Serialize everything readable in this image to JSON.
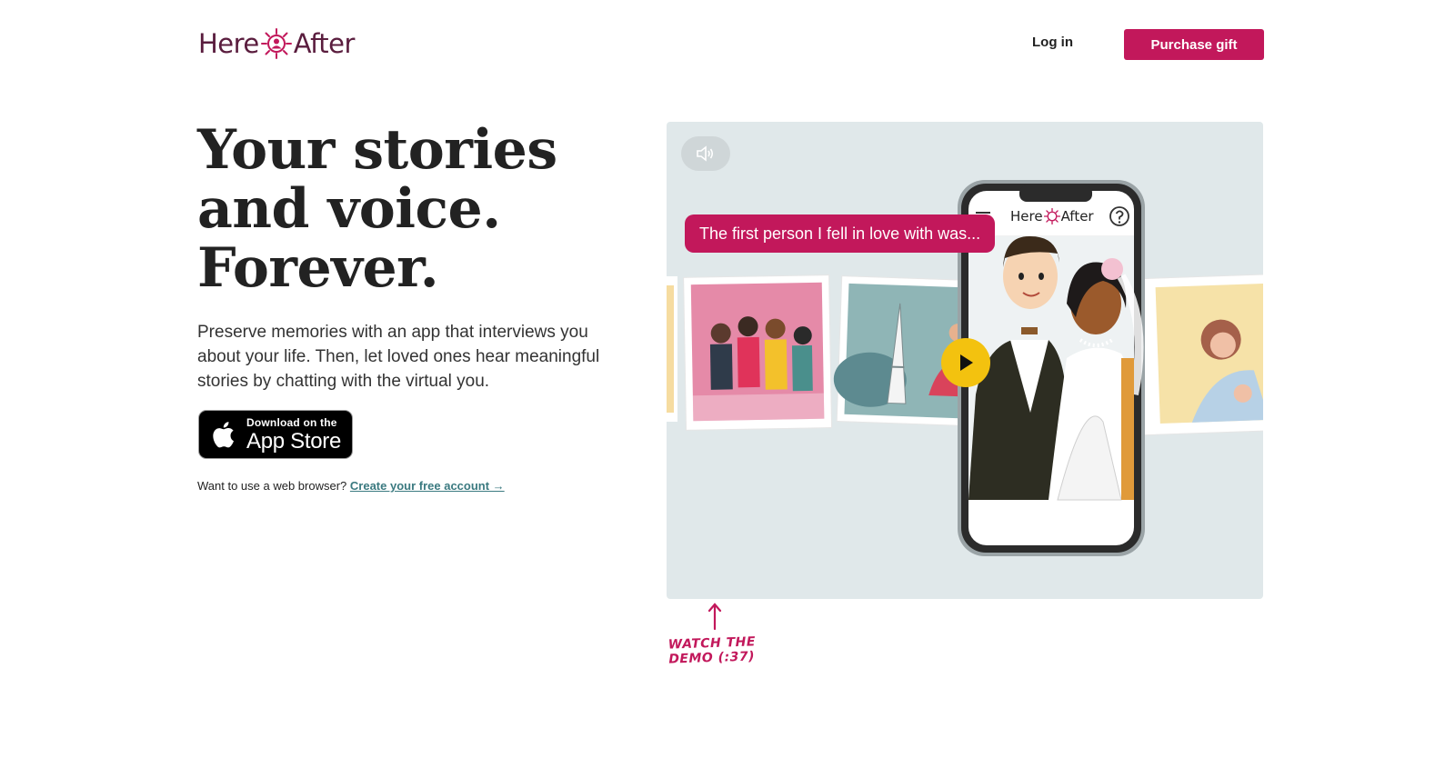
{
  "brand": {
    "name_left": "Here",
    "name_right": "After",
    "color": "#5a1d3e",
    "accent": "#c2185b",
    "icon": "sun-person-icon"
  },
  "nav": {
    "login_label": "Log in",
    "purchase_label": "Purchase gift"
  },
  "hero": {
    "title_lines": [
      "Your stories",
      "and voice.",
      "Forever."
    ],
    "description": "Preserve memories with an app that interviews you about your life. Then, let loved ones hear meaningful stories by chatting with the virtual you.",
    "appstore": {
      "small_label": "Download on the",
      "big_label": "App Store",
      "icon": "apple-icon"
    },
    "web_prompt": "Want to use a web browser?",
    "web_link": "Create your free account →"
  },
  "video": {
    "mute_icon": "speaker-icon",
    "bubble_text": "The first person I fell in love with was...",
    "phone_app_name_left": "Here",
    "phone_app_name_right": "After",
    "help_icon": "question-icon",
    "menu_icon": "hamburger-icon",
    "play_icon": "play-icon",
    "background": "#e0e8ea"
  },
  "demo_note": {
    "line1": "WATCH THE",
    "line2": "DEMO (:37)"
  }
}
